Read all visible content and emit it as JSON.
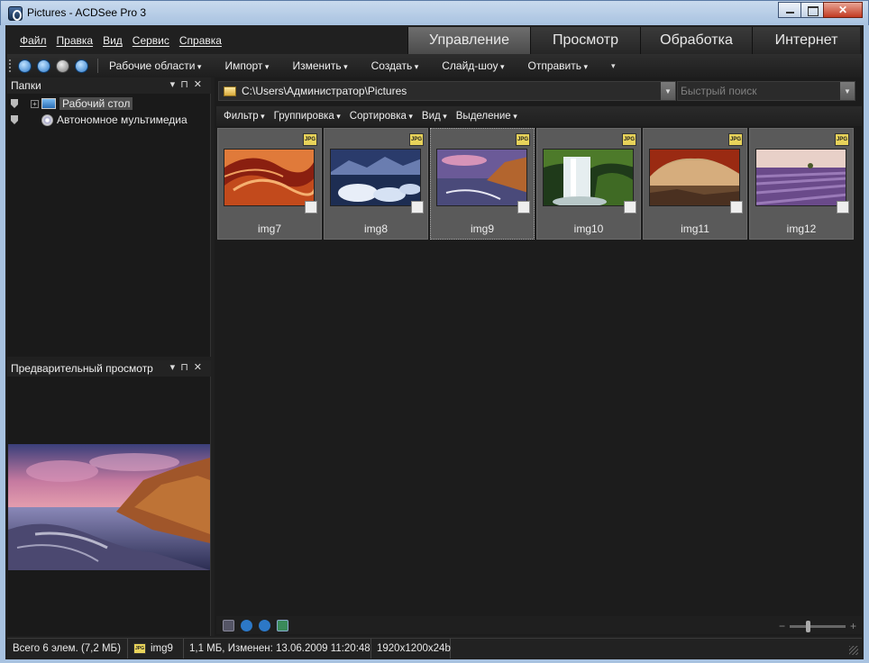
{
  "window": {
    "title": "Pictures - ACDSee Pro 3"
  },
  "menu": [
    "Файл",
    "Правка",
    "Вид",
    "Сервис",
    "Справка"
  ],
  "modes": [
    {
      "label": "Управление",
      "active": true
    },
    {
      "label": "Просмотр",
      "active": false
    },
    {
      "label": "Обработка",
      "active": false
    },
    {
      "label": "Интернет",
      "active": false
    }
  ],
  "toolbar": {
    "nav_icons": [
      "home-icon",
      "back-icon",
      "forward-icon",
      "up-icon"
    ],
    "items": [
      "Рабочие области",
      "Импорт",
      "Изменить",
      "Создать",
      "Слайд-шоу",
      "Отправить"
    ]
  },
  "folders_panel": {
    "title": "Папки",
    "items": [
      {
        "label": "Рабочий стол",
        "icon": "desktop-icon",
        "selected": true
      },
      {
        "label": "Автономное мультимедиа",
        "icon": "disc-icon",
        "selected": false
      }
    ]
  },
  "preview_panel": {
    "title": "Предварительный просмотр"
  },
  "address": {
    "path": "C:\\Users\\Администратор\\Pictures"
  },
  "search": {
    "placeholder": "Быстрый поиск"
  },
  "filterbar": [
    "Фильтр",
    "Группировка",
    "Сортировка",
    "Вид",
    "Выделение"
  ],
  "thumbnails": [
    {
      "name": "img7",
      "badge": "JPG",
      "current": false
    },
    {
      "name": "img8",
      "badge": "JPG",
      "current": false
    },
    {
      "name": "img9",
      "badge": "JPG",
      "current": true
    },
    {
      "name": "img10",
      "badge": "JPG",
      "current": false
    },
    {
      "name": "img11",
      "badge": "JPG",
      "current": false
    },
    {
      "name": "img12",
      "badge": "JPG",
      "current": false
    }
  ],
  "zoom": {
    "minus": "−",
    "plus": "+"
  },
  "status": {
    "total": "Всего 6 элем.  (7,2 МБ)",
    "badge": "JPG",
    "selected": "img9",
    "info": "1,1 МБ, Изменен: 13.06.2009 11:20:48",
    "dims": "1920x1200x24b"
  },
  "colors": {
    "accent": "#2c78c7",
    "background": "#1c1c1c",
    "titlebar": "#a8c2e0"
  }
}
